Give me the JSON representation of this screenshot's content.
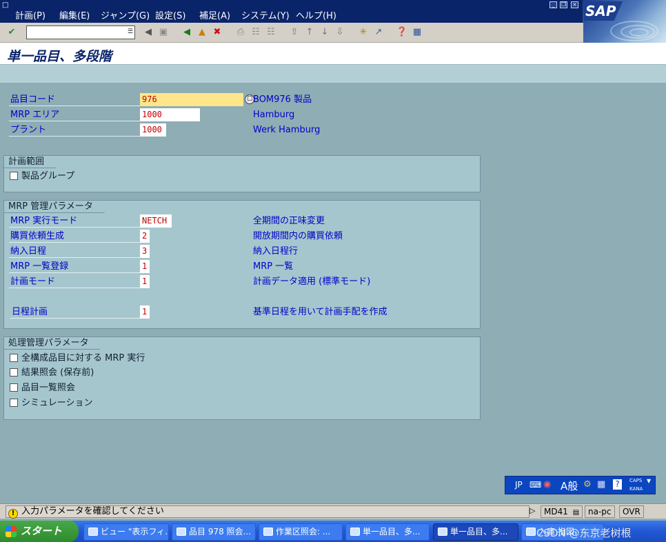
{
  "menu": {
    "items": [
      "計画(P)",
      "編集(E)",
      "ジャンプ(G)",
      "設定(S)",
      "補足(A)",
      "システム(Y)",
      "ヘルプ(H)"
    ]
  },
  "logo": "SAP",
  "title": "単一品目、多段階",
  "header_fields": [
    {
      "label": "品目コード",
      "value": "976",
      "desc": "BOM976 製品"
    },
    {
      "label": "MRP エリア",
      "value": "1000",
      "desc": "Hamburg"
    },
    {
      "label": "プラント",
      "value": "1000",
      "desc": "Werk Hamburg"
    }
  ],
  "group_scope": {
    "title": "計画範囲",
    "checkbox": "製品グループ"
  },
  "group_mrp": {
    "title": "MRP 管理パラメータ",
    "rows": [
      {
        "label": "MRP 実行モード",
        "value": "NETCH",
        "desc": "全期間の正味変更"
      },
      {
        "label": "購買依頼生成",
        "value": "2",
        "desc": "開放期間内の購買依頼"
      },
      {
        "label": "納入日程",
        "value": "3",
        "desc": "納入日程行"
      },
      {
        "label": "MRP 一覧登録",
        "value": "1",
        "desc": "MRP 一覧"
      },
      {
        "label": "計画モード",
        "value": "1",
        "desc": "計画データ適用 (標準モード)"
      },
      {
        "label": "日程計画",
        "value": "1",
        "desc": "基準日程を用いて計画手配を作成"
      }
    ]
  },
  "group_process": {
    "title": "処理管理パラメータ",
    "checkboxes": [
      "全構成品目に対する MRP 実行",
      "結果照会 (保存前)",
      "品目一覧照会",
      "シミュレーション"
    ]
  },
  "ime": {
    "lang": "JP",
    "mode": "A般",
    "caps": "CAPS",
    "kana": "KANA"
  },
  "status": {
    "message": "入力パラメータを確認してください",
    "tcode": "MD41",
    "host": "na-pc",
    "mode": "OVR"
  },
  "taskbar": {
    "start": "スタート",
    "tasks": [
      "ビュー \"表示フィ...",
      "品目 978 照会...",
      "作業区照会: ...",
      "単一品目、多...",
      "単一品目、多...",
      "入庫 指図"
    ]
  },
  "watermark": "CSDN @东京老树根"
}
